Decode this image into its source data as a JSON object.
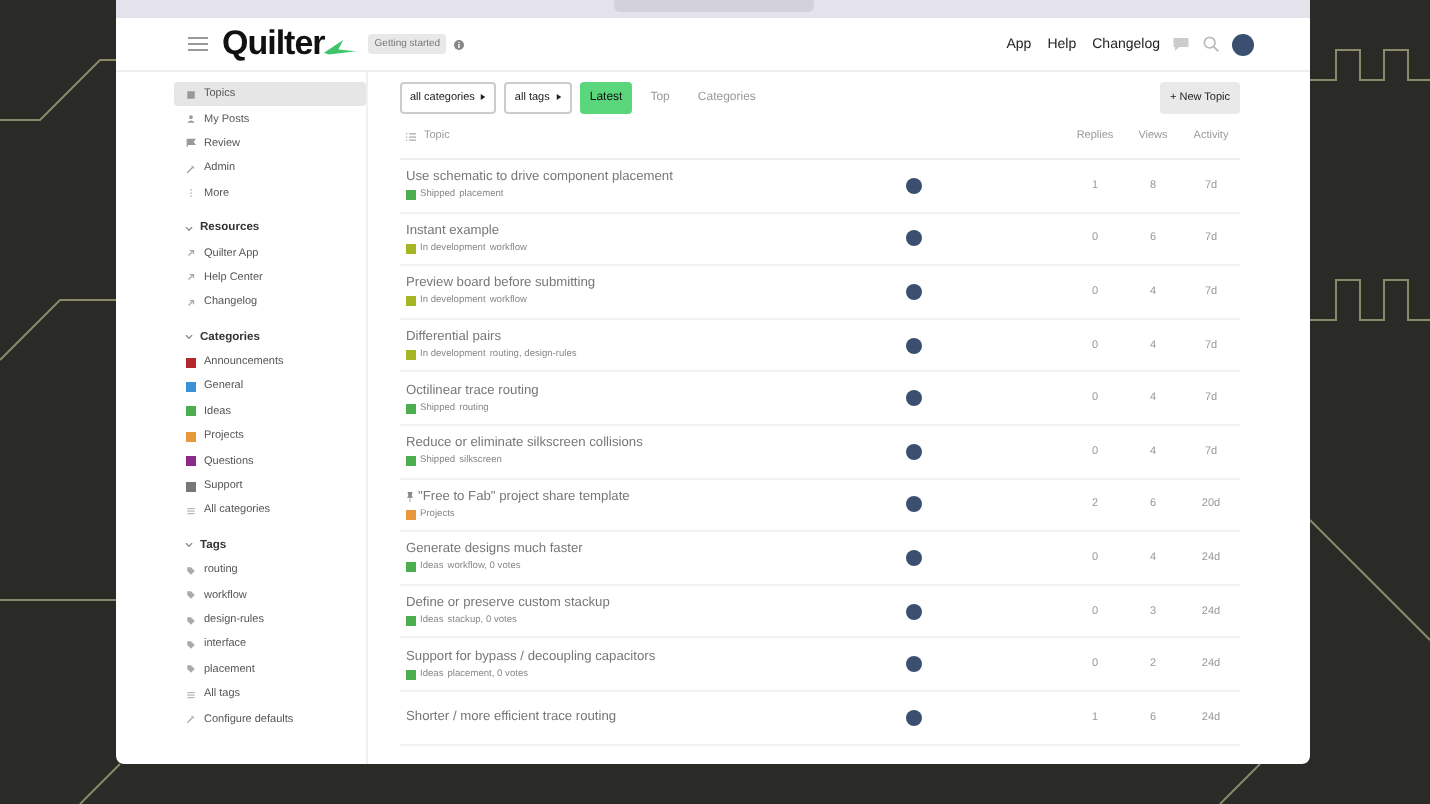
{
  "header": {
    "logo": "Quilter",
    "badge": "Getting started",
    "links": [
      "App",
      "Help",
      "Changelog"
    ]
  },
  "sidebar": {
    "nav": [
      {
        "label": "Topics",
        "selected": true
      },
      {
        "label": "My Posts",
        "selected": false
      },
      {
        "label": "Review",
        "selected": false
      },
      {
        "label": "Admin",
        "selected": false
      },
      {
        "label": "More",
        "selected": false
      }
    ],
    "sections": [
      {
        "kind": "links",
        "title": "Resources",
        "expanded": true,
        "items": [
          {
            "label": "Quilter App"
          },
          {
            "label": "Help Center"
          },
          {
            "label": "Changelog"
          }
        ]
      },
      {
        "kind": "categories",
        "title": "Categories",
        "expanded": true,
        "items": [
          {
            "label": "Announcements",
            "color": "#b3282d"
          },
          {
            "label": "General",
            "color": "#3a93d8"
          },
          {
            "label": "Ideas",
            "color": "#4cae4f"
          },
          {
            "label": "Projects",
            "color": "#e8973a"
          },
          {
            "label": "Questions",
            "color": "#8c2a8c"
          },
          {
            "label": "Support",
            "color": "#777777"
          }
        ],
        "all": "All categories"
      },
      {
        "kind": "tags",
        "title": "Tags",
        "expanded": true,
        "items": [
          {
            "label": "routing"
          },
          {
            "label": "workflow"
          },
          {
            "label": "design-rules"
          },
          {
            "label": "interface"
          },
          {
            "label": "placement"
          }
        ],
        "all": "All tags",
        "config": "Configure defaults"
      }
    ]
  },
  "filters": {
    "dropdowns": [
      "all categories",
      "all tags"
    ],
    "tabs": [
      {
        "label": "Latest",
        "selected": true
      },
      {
        "label": "Top",
        "selected": false
      },
      {
        "label": "Categories",
        "selected": false
      }
    ],
    "new_topic": "+ New Topic"
  },
  "table": {
    "columns": [
      "Topic",
      "Replies",
      "Views",
      "Activity"
    ],
    "rows": [
      {
        "title": "Use schematic to drive component placement",
        "pinned": false,
        "category": "Shipped",
        "color": "#4cae4f",
        "tags": "placement",
        "replies": "1",
        "views": "8",
        "activity": "7d"
      },
      {
        "title": "Instant example",
        "pinned": false,
        "category": "In development",
        "color": "#a6b526",
        "tags": "workflow",
        "replies": "0",
        "views": "6",
        "activity": "7d"
      },
      {
        "title": "Preview board before submitting",
        "pinned": false,
        "category": "In development",
        "color": "#a6b526",
        "tags": "workflow",
        "replies": "0",
        "views": "4",
        "activity": "7d"
      },
      {
        "title": "Differential pairs",
        "pinned": false,
        "category": "In development",
        "color": "#a6b526",
        "tags": "routing, design-rules",
        "replies": "0",
        "views": "4",
        "activity": "7d"
      },
      {
        "title": "Octilinear trace routing",
        "pinned": false,
        "category": "Shipped",
        "color": "#4cae4f",
        "tags": "routing",
        "replies": "0",
        "views": "4",
        "activity": "7d"
      },
      {
        "title": "Reduce or eliminate silkscreen collisions",
        "pinned": false,
        "category": "Shipped",
        "color": "#4cae4f",
        "tags": "silkscreen",
        "replies": "0",
        "views": "4",
        "activity": "7d"
      },
      {
        "title": "\"Free to Fab\" project share template",
        "pinned": true,
        "category": "Projects",
        "color": "#e8973a",
        "tags": "",
        "replies": "2",
        "views": "6",
        "activity": "20d"
      },
      {
        "title": "Generate designs much faster",
        "pinned": false,
        "category": "Ideas",
        "color": "#4cae4f",
        "tags": "workflow, 0 votes",
        "replies": "0",
        "views": "4",
        "activity": "24d"
      },
      {
        "title": "Define or preserve custom stackup",
        "pinned": false,
        "category": "Ideas",
        "color": "#4cae4f",
        "tags": "stackup, 0 votes",
        "replies": "0",
        "views": "3",
        "activity": "24d"
      },
      {
        "title": "Support for bypass / decoupling capacitors",
        "pinned": false,
        "category": "Ideas",
        "color": "#4cae4f",
        "tags": "placement, 0 votes",
        "replies": "0",
        "views": "2",
        "activity": "24d"
      },
      {
        "title": "Shorter / more efficient trace routing",
        "pinned": false,
        "replies": "1",
        "views": "6",
        "activity": "24d"
      }
    ]
  }
}
